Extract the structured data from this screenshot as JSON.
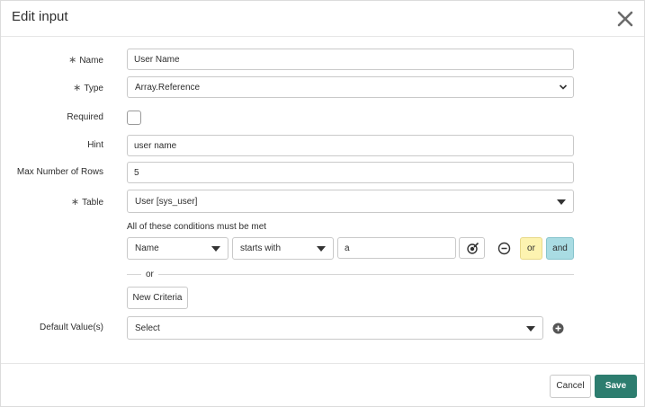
{
  "dialog": {
    "title": "Edit input",
    "close_icon": "close-icon"
  },
  "fields": {
    "name": {
      "label": "Name",
      "required": true,
      "value": "User Name"
    },
    "type": {
      "label": "Type",
      "required": true,
      "value": "Array.Reference"
    },
    "required": {
      "label": "Required",
      "checked": false
    },
    "hint": {
      "label": "Hint",
      "value": "user name"
    },
    "max_rows": {
      "label": "Max Number of Rows",
      "value": "5"
    },
    "table": {
      "label": "Table",
      "required": true,
      "value": "User [sys_user]"
    },
    "default_values": {
      "label": "Default Value(s)",
      "placeholder": "Select"
    }
  },
  "required_marker": "∗",
  "conditions": {
    "heading": "All of these conditions must be met",
    "field": "Name",
    "operator": "starts with",
    "value": "a",
    "or_button": "or",
    "and_button": "and",
    "separator": "or",
    "new_criteria_button": "New Criteria"
  },
  "footer": {
    "cancel_label": "Cancel",
    "save_label": "Save"
  },
  "colors": {
    "save_bg": "#2d7d6f",
    "or_bg": "#fdf3b0",
    "and_bg": "#a9dce3"
  }
}
